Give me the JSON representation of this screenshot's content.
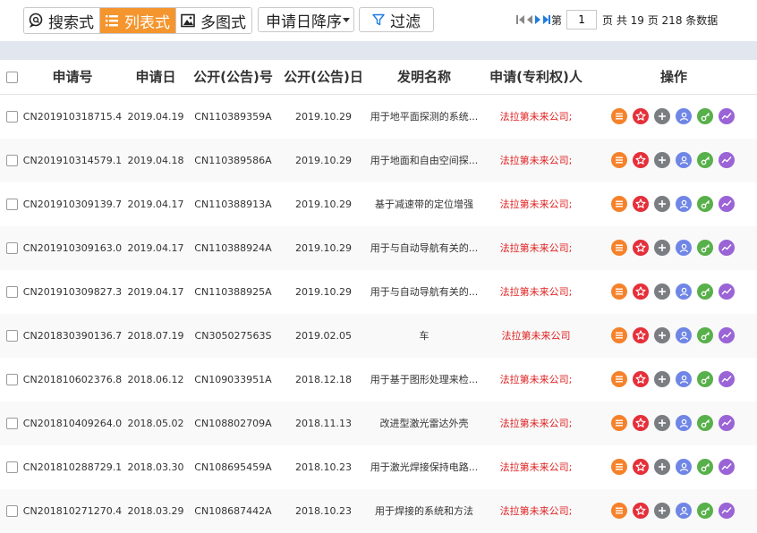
{
  "toolbar": {
    "views": [
      {
        "label": "搜索式",
        "icon": "search-bubble-icon"
      },
      {
        "label": "列表式",
        "icon": "list-icon",
        "active": true
      },
      {
        "label": "多图式",
        "icon": "image-icon"
      }
    ],
    "sort_label": "申请日降序",
    "filter_label": "过滤"
  },
  "pager": {
    "page_prefix": "第",
    "current_page": "1",
    "summary": "页 共 19 页 218 条数据"
  },
  "table": {
    "headers": [
      "申请号",
      "申请日",
      "公开(公告)号",
      "公开(公告)日",
      "发明名称",
      "申请(专利权)人",
      "操作"
    ],
    "rows": [
      {
        "app_no": "CN201910318715.4",
        "app_date": "2019.04.19",
        "pub_no": "CN110389359A",
        "pub_date": "2019.10.29",
        "title": "用于地平面探测的系统...",
        "applicant": "法拉第未来公司;"
      },
      {
        "app_no": "CN201910314579.1",
        "app_date": "2019.04.18",
        "pub_no": "CN110389586A",
        "pub_date": "2019.10.29",
        "title": "用于地面和自由空间探...",
        "applicant": "法拉第未来公司;"
      },
      {
        "app_no": "CN201910309139.7",
        "app_date": "2019.04.17",
        "pub_no": "CN110388913A",
        "pub_date": "2019.10.29",
        "title": "基于减速带的定位增强",
        "applicant": "法拉第未来公司;"
      },
      {
        "app_no": "CN201910309163.0",
        "app_date": "2019.04.17",
        "pub_no": "CN110388924A",
        "pub_date": "2019.10.29",
        "title": "用于与自动导航有关的...",
        "applicant": "法拉第未来公司;"
      },
      {
        "app_no": "CN201910309827.3",
        "app_date": "2019.04.17",
        "pub_no": "CN110388925A",
        "pub_date": "2019.10.29",
        "title": "用于与自动导航有关的...",
        "applicant": "法拉第未来公司;"
      },
      {
        "app_no": "CN201830390136.7",
        "app_date": "2018.07.19",
        "pub_no": "CN305027563S",
        "pub_date": "2019.02.05",
        "title": "车",
        "applicant": "法拉第未来公司"
      },
      {
        "app_no": "CN201810602376.8",
        "app_date": "2018.06.12",
        "pub_no": "CN109033951A",
        "pub_date": "2018.12.18",
        "title": "用于基于图形处理来检...",
        "applicant": "法拉第未来公司;"
      },
      {
        "app_no": "CN201810409264.0",
        "app_date": "2018.05.02",
        "pub_no": "CN108802709A",
        "pub_date": "2018.11.13",
        "title": "改进型激光雷达外壳",
        "applicant": "法拉第未来公司;"
      },
      {
        "app_no": "CN201810288729.1",
        "app_date": "2018.03.30",
        "pub_no": "CN108695459A",
        "pub_date": "2018.10.23",
        "title": "用于激光焊接保持电路...",
        "applicant": "法拉第未来公司;"
      },
      {
        "app_no": "CN201810271270.4",
        "app_date": "2018.03.29",
        "pub_no": "CN108687442A",
        "pub_date": "2018.10.23",
        "title": "用于焊接的系统和方法",
        "applicant": "法拉第未来公司;"
      }
    ],
    "row_actions": [
      {
        "icon": "list-detail-icon",
        "color": "#f5822a"
      },
      {
        "icon": "star-icon",
        "color": "#e5303a"
      },
      {
        "icon": "plus-icon",
        "color": "#7a7d82"
      },
      {
        "icon": "person-icon",
        "color": "#6f86e6"
      },
      {
        "icon": "key-icon",
        "color": "#58b04a"
      },
      {
        "icon": "trend-icon",
        "color": "#9a63d6"
      }
    ]
  },
  "colors": {
    "accent": "#f5952e",
    "applicant_text": "#e02020",
    "pager_active": "#1f7be0",
    "header_band": "#e1e6ef"
  }
}
